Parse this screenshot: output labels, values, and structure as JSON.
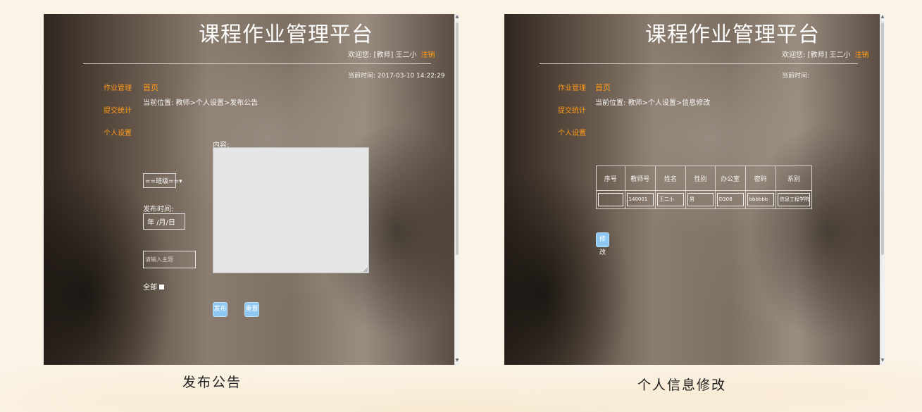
{
  "left_screen": {
    "app_title": "课程作业管理平台",
    "welcome_text": "欢迎您: [教师] 王二小",
    "logout_label": "注销",
    "current_time": "当前时间: 2017-03-10 14:22:29",
    "nav": [
      "作业管理",
      "提交统计",
      "个人设置"
    ],
    "home_link": "首页",
    "breadcrumb": "当前位置: 教师>个人设置>发布公告",
    "content_label": "内容:",
    "class_select_value": "==班级==",
    "publish_time_label": "发布时间:",
    "date_placeholder": "年 /月/日",
    "subject_placeholder": "请输入主题",
    "all_label": "全部",
    "publish_button": "发布",
    "reset_button": "重置"
  },
  "right_screen": {
    "app_title": "课程作业管理平台",
    "welcome_text": "欢迎您: [教师] 王二小",
    "logout_label": "注销",
    "current_time": "当前时间:",
    "nav": [
      "作业管理",
      "提交统计",
      "个人设置"
    ],
    "home_link": "首页",
    "breadcrumb": "当前位置: 教师>个人设置>信息修改",
    "table": {
      "headers": [
        "序号",
        "教师号",
        "姓名",
        "性别",
        "办公室",
        "密码",
        "系别"
      ],
      "row": [
        "",
        "140001",
        "王二小",
        "男",
        "D308",
        "bbbbbb",
        "信息工程学院"
      ]
    },
    "modify_button": "修改"
  },
  "captions": {
    "left": "发布公告",
    "right": "个人信息修改"
  },
  "colors": {
    "accent": "#ff9a18",
    "button": "#8ec8f2",
    "page_background": "#fbf3e6"
  }
}
